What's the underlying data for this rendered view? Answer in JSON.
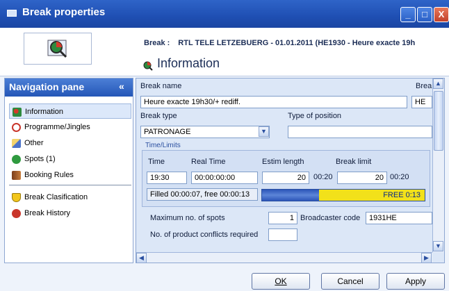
{
  "window": {
    "title": "Break properties",
    "controls": {
      "minimize": "_",
      "maximize": "□",
      "close": "X"
    }
  },
  "header": {
    "break_key": "Break :",
    "break_value": "RTL TELE LETZEBUERG - 01.01.2011 (HE1930 - Heure exacte 19h",
    "section_title": "Information"
  },
  "navigation": {
    "title": "Navigation pane",
    "collapse": "«",
    "items": [
      {
        "label": "Information",
        "icon": "magnifier-icon",
        "selected": true
      },
      {
        "label": "Programme/Jingles",
        "icon": "clock-icon"
      },
      {
        "label": "Other",
        "icon": "pencil-icon"
      },
      {
        "label": "Spots (1)",
        "icon": "play-icon"
      },
      {
        "label": "Booking Rules",
        "icon": "book-icon"
      },
      {
        "label": "Break Clasification",
        "icon": "shield-icon"
      },
      {
        "label": "Break History",
        "icon": "history-icon"
      }
    ]
  },
  "form": {
    "break_name_label": "Break name",
    "break_name_value": "Heure exacte 19h30/+ rediff.",
    "break_col2_label": "Brea",
    "break_col2_value": "HE",
    "break_type_label": "Break type",
    "break_type_value": "PATRONAGE",
    "type_of_position_label": "Type of position",
    "type_of_position_value": "",
    "time_limits_label": "Time/Limits",
    "time_label": "Time",
    "real_time_label": "Real Time",
    "estim_length_label": "Estim length",
    "break_limit_label": "Break limit",
    "time_value": "19:30",
    "real_time_value": "00:00:00:00",
    "estim_length_value": "20",
    "estim_length_time": "00:20",
    "break_limit_value": "20",
    "break_limit_time": "00:20",
    "filled_text": "Filled 00:00:07, free 00:00:13",
    "free_label": "FREE 0:13",
    "progress_fraction": 0.35,
    "max_spots_label": "Maximum no. of spots",
    "max_spots_value": "1",
    "broadcaster_label": "Broadcaster code",
    "broadcaster_value": "1931HE",
    "product_conflicts_label": "No. of product conflicts required",
    "product_conflicts_value": ""
  },
  "buttons": {
    "ok": "OK",
    "cancel": "Cancel",
    "apply": "Apply"
  },
  "colors": {
    "titlebar": "#2456b7",
    "progress_fill": "#2c55b8",
    "progress_free": "#f2e11a"
  }
}
